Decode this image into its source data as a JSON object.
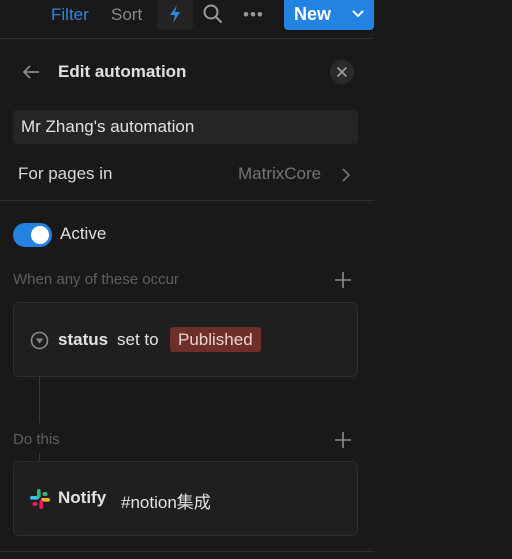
{
  "toolbar": {
    "filter_label": "Filter",
    "sort_label": "Sort",
    "automation_icon": "lightning-bolt-icon",
    "search_icon": "search-icon",
    "more_label": "•••",
    "new_label": "New",
    "new_dropdown_icon": "chevron-down-icon",
    "accent_color": "#2383e2",
    "filter_color": "#2f86d9"
  },
  "header": {
    "back_icon": "arrow-left-icon",
    "title": "Edit automation",
    "close_icon": "close-icon"
  },
  "automation": {
    "name": "Mr Zhang's automation",
    "scope_label": "For pages in",
    "scope_value": "MatrixCore",
    "active": true,
    "active_label": "Active"
  },
  "triggers": {
    "section_label": "When any of these occur",
    "items": [
      {
        "icon": "status-circle-icon",
        "property": "status",
        "verb": "set to",
        "value": "Published",
        "value_color": "#6e2e2a"
      }
    ]
  },
  "actions": {
    "section_label": "Do this",
    "items": [
      {
        "icon": "slack-icon",
        "verb": "Notify",
        "target": "#notion集成"
      }
    ]
  }
}
